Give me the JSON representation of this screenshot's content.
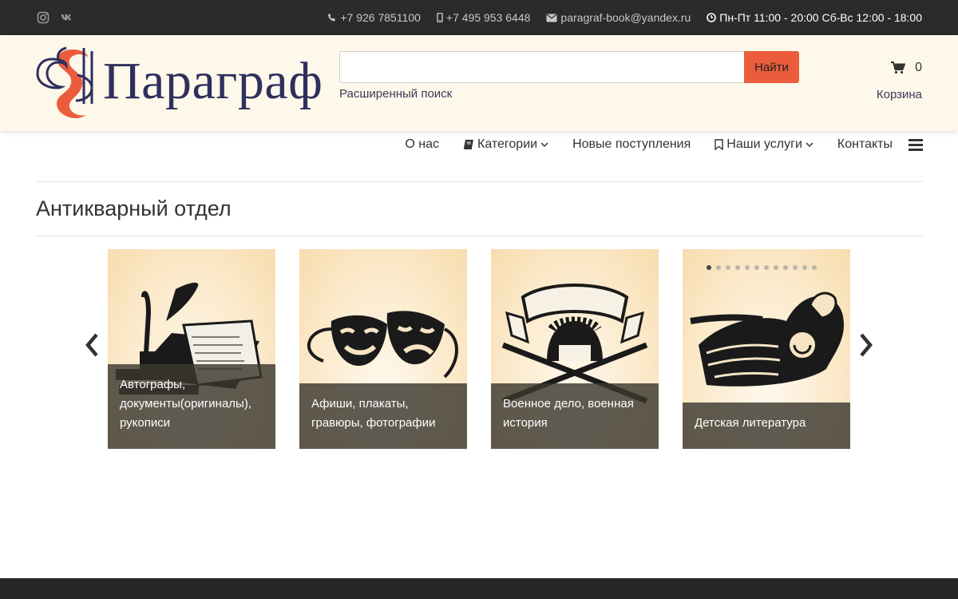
{
  "topbar": {
    "social": [
      {
        "icon": "instagram-icon"
      },
      {
        "icon": "vk-icon"
      }
    ],
    "phone1": "+7 926 7851100",
    "phone2": "+7 495 953 6448",
    "email": "paragraf-book@yandex.ru",
    "hours": "Пн-Пт 11:00 - 20:00 Сб-Вс 12:00 - 18:00"
  },
  "header": {
    "logo_text": "Параграф",
    "search": {
      "placeholder": "",
      "button_label": "Найти",
      "advanced_link": "Расширенный поиск"
    },
    "cart": {
      "count": "0",
      "label": "Корзина"
    }
  },
  "nav": {
    "items": [
      {
        "label": "О нас"
      },
      {
        "label": "Категории",
        "icon": "book-icon"
      },
      {
        "label": "Новые поступления"
      },
      {
        "label": "Наши услуги",
        "icon": "bookmark-icon"
      },
      {
        "label": "Контакты"
      }
    ]
  },
  "section": {
    "title": "Антикварный отдел"
  },
  "carousel": {
    "cards": [
      {
        "caption": "Автографы, документы(оригиналы), рукописи",
        "icon": "quill-manuscript-icon"
      },
      {
        "caption": "Афиши, плакаты, гравюры, фотографии",
        "icon": "theater-masks-icon"
      },
      {
        "caption": "Военное дело, военная история",
        "icon": "helmet-swords-icon"
      },
      {
        "caption": "Детская литература",
        "icon": "firebird-icon"
      }
    ],
    "dots_total": 12,
    "dots_active": 0
  },
  "colors": {
    "accent": "#ea5c3b",
    "brand": "#2f2f5e",
    "header_bg": "#fdf8ea",
    "topbar_bg": "#2b2b2b"
  }
}
